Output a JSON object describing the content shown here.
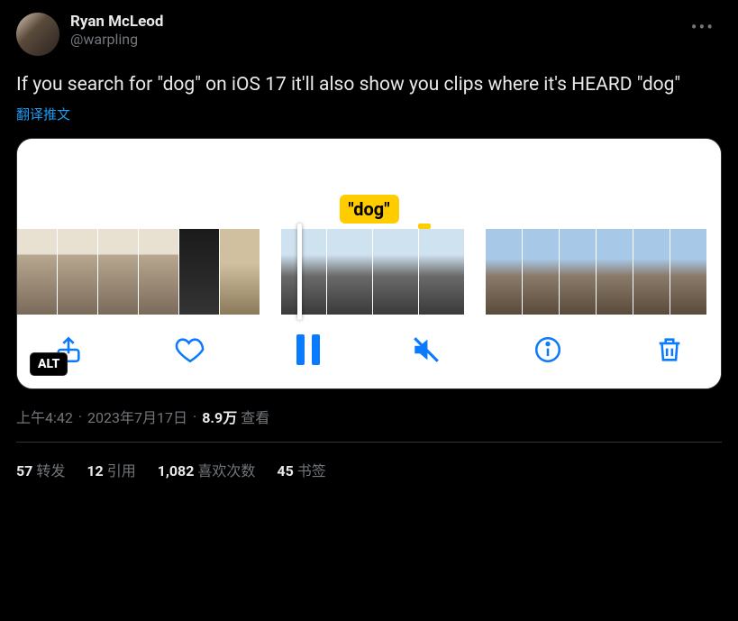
{
  "author": {
    "display_name": "Ryan McLeod",
    "handle": "@warpling"
  },
  "tweet_text": "If you search for \"dog\" on iOS 17 it'll also show you clips where it's HEARD \"dog\"",
  "translate_label": "翻译推文",
  "media": {
    "caption_tag": "\"dog\"",
    "alt_badge": "ALT"
  },
  "meta": {
    "time": "上午4:42",
    "date": "2023年7月17日",
    "views_count": "8.9万",
    "views_label": "查看"
  },
  "stats": {
    "retweets_count": "57",
    "retweets_label": "转发",
    "quotes_count": "12",
    "quotes_label": "引用",
    "likes_count": "1,082",
    "likes_label": "喜欢次数",
    "bookmarks_count": "45",
    "bookmarks_label": "书签"
  }
}
